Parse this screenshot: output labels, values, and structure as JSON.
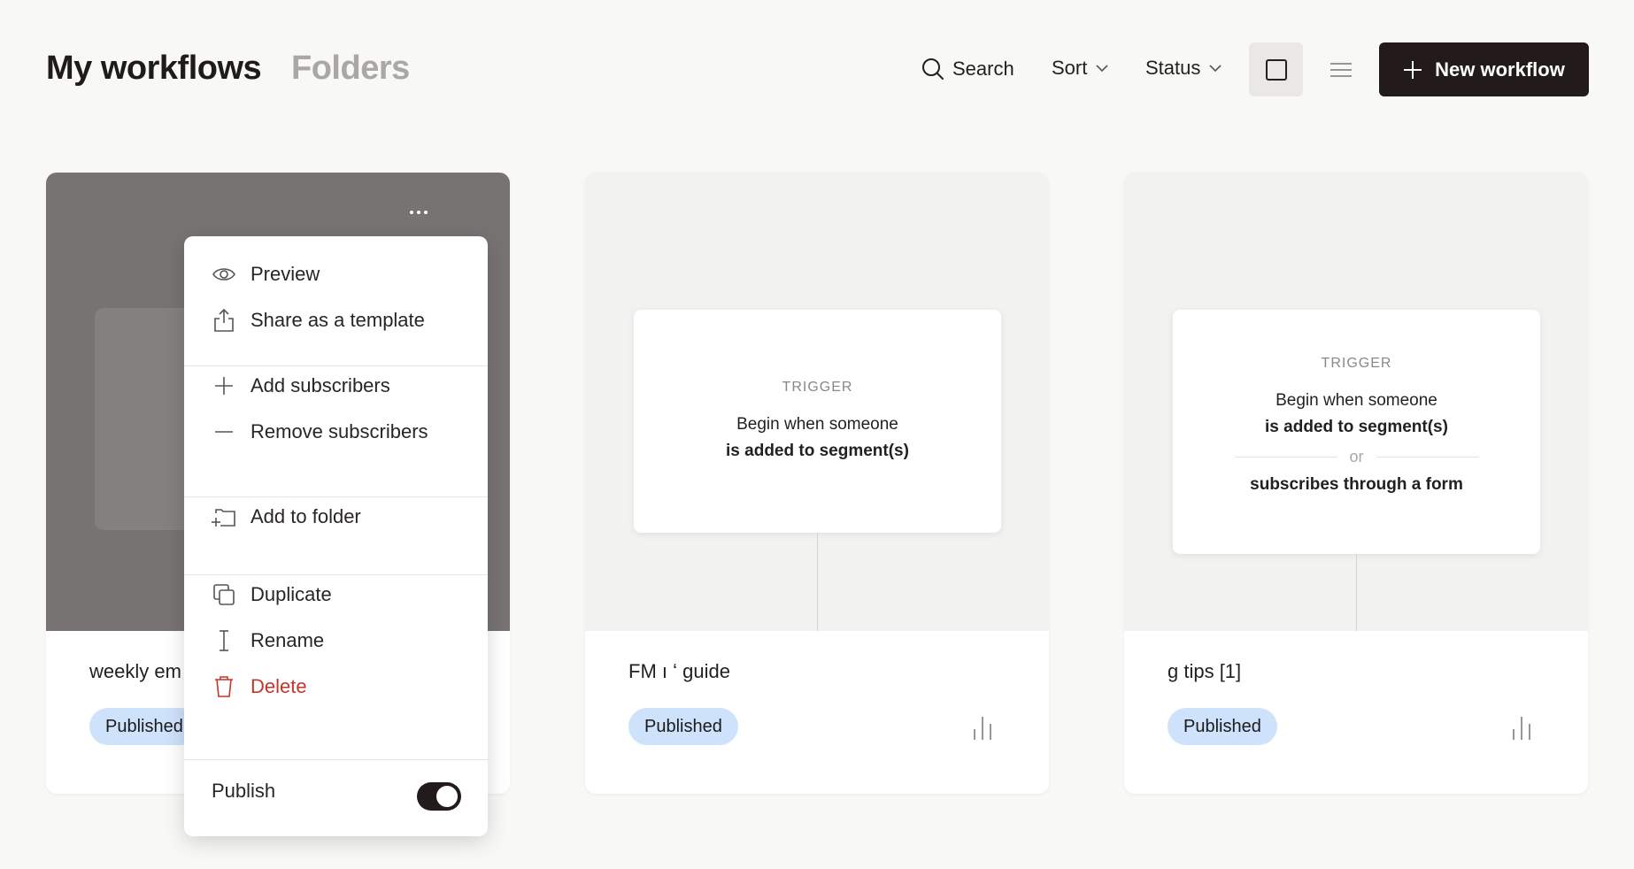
{
  "header": {
    "title": "My workflows",
    "folders_tab": "Folders",
    "search_label": "Search",
    "sort_label": "Sort",
    "status_label": "Status",
    "new_button_label": "New workflow"
  },
  "cards": [
    {
      "name": "weekly em",
      "status": "Published"
    },
    {
      "name": "FM ı                                          ʻ guide",
      "status": "Published",
      "trigger": {
        "label": "TRIGGER",
        "line1": "Begin when someone",
        "line2": "is added to segment(s)"
      }
    },
    {
      "name": "                          g tips [1]",
      "status": "Published",
      "trigger": {
        "label": "TRIGGER",
        "line1": "Begin when someone",
        "line2": "is added to segment(s)",
        "or": "or",
        "line3": "subscribes through a form"
      }
    }
  ],
  "menu": {
    "items": [
      {
        "label": "Preview",
        "icon": "eye-icon"
      },
      {
        "label": "Share as a template",
        "icon": "share-icon"
      },
      {
        "label": "Add subscribers",
        "icon": "plus-icon"
      },
      {
        "label": "Remove subscribers",
        "icon": "minus-icon"
      },
      {
        "label": "Add to folder",
        "icon": "folder-add-icon"
      },
      {
        "label": "Duplicate",
        "icon": "duplicate-icon"
      },
      {
        "label": "Rename",
        "icon": "text-cursor-icon"
      },
      {
        "label": "Delete",
        "icon": "trash-icon"
      }
    ],
    "publish_label": "Publish",
    "publish_on": true
  },
  "colors": {
    "accent_dark": "#231b1b",
    "badge_bg": "#cfe2fb",
    "danger": "#c6352a"
  }
}
